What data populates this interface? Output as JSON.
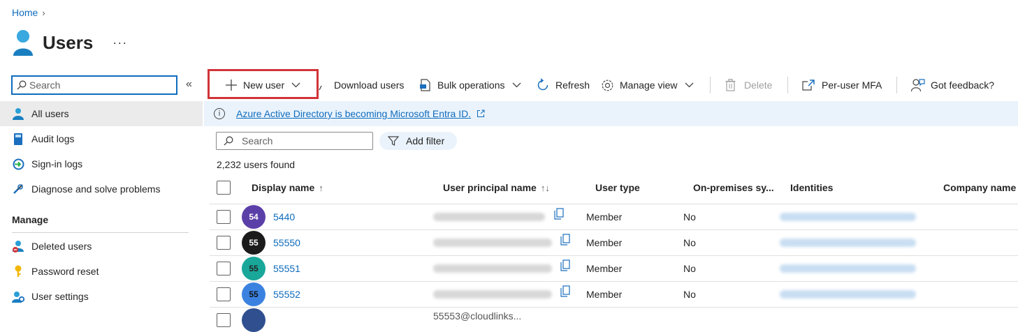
{
  "breadcrumb": {
    "home": "Home",
    "separator": "›"
  },
  "page": {
    "title": "Users",
    "more": "···"
  },
  "sidebar": {
    "search_placeholder": "Search",
    "collapse": "«",
    "items": [
      {
        "label": "All users",
        "icon": "user-icon",
        "selected": true
      },
      {
        "label": "Audit logs",
        "icon": "book-icon"
      },
      {
        "label": "Sign-in logs",
        "icon": "sign-in-icon"
      },
      {
        "label": "Diagnose and solve problems",
        "icon": "wrench-icon"
      }
    ],
    "manage_header": "Manage",
    "manage_items": [
      {
        "label": "Deleted users",
        "icon": "deleted-user-icon"
      },
      {
        "label": "Password reset",
        "icon": "key-icon"
      },
      {
        "label": "User settings",
        "icon": "user-settings-icon"
      }
    ]
  },
  "toolbar": {
    "new_user": "New user",
    "download_users": "Download users",
    "bulk_operations": "Bulk operations",
    "refresh": "Refresh",
    "manage_view": "Manage view",
    "delete": "Delete",
    "per_user_mfa": "Per-user MFA",
    "got_feedback": "Got feedback?"
  },
  "banner": {
    "text": "Azure Active Directory is becoming Microsoft Entra ID.",
    "icon": "info-icon"
  },
  "filter": {
    "search_placeholder": "Search",
    "add_filter": "Add filter"
  },
  "results": {
    "count_text": "2,232 users found"
  },
  "table": {
    "columns": {
      "display_name": "Display name",
      "display_name_sort": "↑",
      "upn": "User principal name",
      "upn_sort": "↑↓",
      "user_type": "User type",
      "on_prem": "On-premises sy...",
      "identities": "Identities",
      "company": "Company name"
    },
    "rows": [
      {
        "initials": "54",
        "name": "5440",
        "user_type": "Member",
        "on_prem": "No",
        "avatar_color": "#5b3fa8"
      },
      {
        "initials": "55",
        "name": "55550",
        "user_type": "Member",
        "on_prem": "No",
        "avatar_color": "#1b1b1b"
      },
      {
        "initials": "55",
        "name": "55551",
        "user_type": "Member",
        "on_prem": "No",
        "avatar_color": "#19a79a"
      },
      {
        "initials": "55",
        "name": "55552",
        "user_type": "Member",
        "on_prem": "No",
        "avatar_color": "#3b82e0"
      }
    ],
    "partial_row": {
      "upn_fragment": "55553@cloudlinks..."
    }
  },
  "colors": {
    "accent": "#0f6cbd",
    "highlight": "#d13438",
    "banner_bg": "#eaf3fc"
  }
}
